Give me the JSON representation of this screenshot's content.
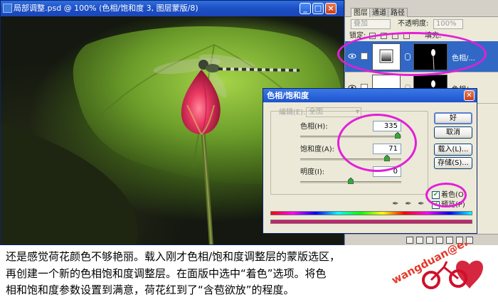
{
  "document_window": {
    "title": "局部调整.psd @ 100% (色相/饱和度 3, 图层蒙版/8)",
    "minimize_label": "_",
    "maximize_label": "□",
    "close_label": "×"
  },
  "layers_panel": {
    "tabs": [
      "图层",
      "通道",
      "路径"
    ],
    "blend_mode": "叠加",
    "opacity_label": "不透明度:",
    "opacity_value": "100%",
    "lock_label": "锁定:",
    "fill_label": "填充:",
    "layers": [
      {
        "name": "色相/..."
      },
      {
        "name": "色相/..."
      }
    ]
  },
  "hue_sat_dialog": {
    "title": "色相/饱和度",
    "edit_label": "编辑(E):",
    "edit_value": "全图",
    "hue_label": "色相(H):",
    "hue_value": "335",
    "saturation_label": "饱和度(A):",
    "saturation_value": "71",
    "lightness_label": "明度(I):",
    "lightness_value": "0",
    "ok_label": "好",
    "cancel_label": "取消",
    "load_label": "载入(L)...",
    "save_label": "存储(S)...",
    "colorize_label": "着色(O)",
    "colorize_checked": true,
    "preview_label": "预览(P)",
    "hue_slider_fraction": 0.965,
    "saturation_slider_fraction": 0.86,
    "lightness_slider_fraction": 0.5
  },
  "caption": {
    "lines": [
      "还是感觉荷花颜色不够艳丽。载入刚才色相/饱和度调整层的蒙版选区，",
      "再创建一个新的色相饱和度调整层。在面版中选中“着色”选项。将色",
      "相和饱和度参数设置到满意，荷花红到了“含苞欲放”的程度。"
    ]
  },
  "logo": {
    "text": "wangduan@eNet",
    "highlight_color": "#e21fd8",
    "logo_red": "#d0102a"
  }
}
